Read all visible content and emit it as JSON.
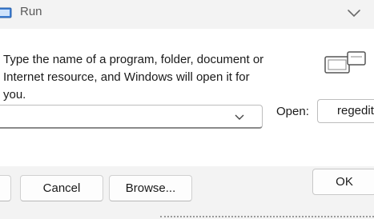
{
  "window": {
    "title": "Run"
  },
  "content": {
    "description_line1": "Type the name of a program, folder, document or",
    "description_line2": "Internet resource, and Windows will open it for you."
  },
  "open_combo": {
    "value": ""
  },
  "open_label": "Open:",
  "open_field": {
    "value": "regedit"
  },
  "buttons": {
    "ok": "OK",
    "cancel": "Cancel",
    "browse": "Browse..."
  },
  "icons": {
    "app": "run-app-icon",
    "run_large": "run-large-icon",
    "close": "close-icon",
    "dropdown": "chevron-down-icon"
  }
}
